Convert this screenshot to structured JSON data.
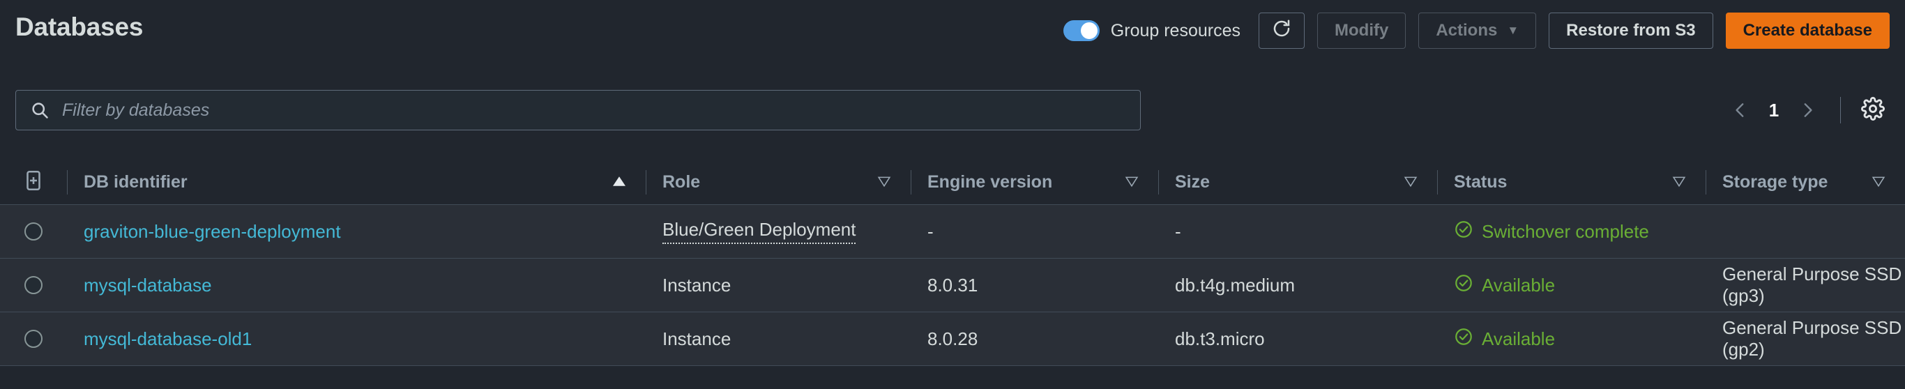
{
  "header": {
    "title": "Databases",
    "group_resources_label": "Group resources",
    "group_resources_on": true,
    "refresh_icon": "refresh-icon",
    "buttons": {
      "modify": "Modify",
      "actions": "Actions",
      "restore": "Restore from S3",
      "create": "Create database"
    },
    "accent_color": "#ec7211",
    "toggle_color": "#539fe5"
  },
  "filter": {
    "placeholder": "Filter by databases",
    "value": "",
    "search_icon": "search-icon"
  },
  "pagination": {
    "prev_icon": "chevron-left-icon",
    "next_icon": "chevron-right-icon",
    "current_page": "1",
    "settings_icon": "gear-icon"
  },
  "table": {
    "expand_all_icon": "expand-all-icon",
    "columns": [
      {
        "label": "DB identifier",
        "sort": "asc"
      },
      {
        "label": "Role",
        "sort": "none"
      },
      {
        "label": "Engine version",
        "sort": "none"
      },
      {
        "label": "Size",
        "sort": "none"
      },
      {
        "label": "Status",
        "sort": "none"
      },
      {
        "label": "Storage type",
        "sort": "none"
      }
    ],
    "rows": [
      {
        "selected": false,
        "db_identifier": "graviton-blue-green-deployment",
        "role": "Blue/Green Deployment",
        "role_dotted": true,
        "engine_version": "-",
        "size": "-",
        "status": "Switchover complete",
        "status_color": "#6aaf35",
        "storage_type": ""
      },
      {
        "selected": false,
        "db_identifier": "mysql-database",
        "role": "Instance",
        "role_dotted": false,
        "engine_version": "8.0.31",
        "size": "db.t4g.medium",
        "status": "Available",
        "status_color": "#6aaf35",
        "storage_type": "General Purpose SSD (gp3)"
      },
      {
        "selected": false,
        "db_identifier": "mysql-database-old1",
        "role": "Instance",
        "role_dotted": false,
        "engine_version": "8.0.28",
        "size": "db.t3.micro",
        "status": "Available",
        "status_color": "#6aaf35",
        "storage_type": "General Purpose SSD (gp2)"
      }
    ]
  }
}
